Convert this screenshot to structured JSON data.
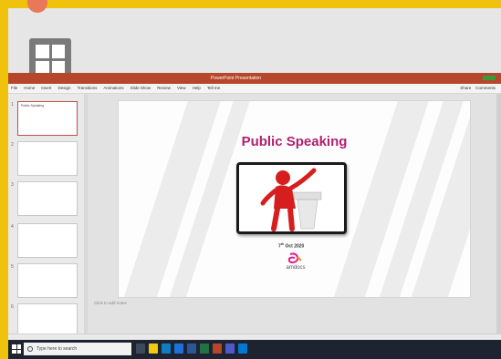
{
  "window": {
    "title": "PowerPoint Presentation",
    "title_left": "",
    "title_right": ""
  },
  "menu": {
    "items": [
      "File",
      "Home",
      "Insert",
      "Design",
      "Transitions",
      "Animations",
      "Slide Show",
      "Review",
      "View",
      "Help",
      "Tell me"
    ],
    "share": "Share",
    "comments": "Comments"
  },
  "thumbnails": [
    {
      "num": "1",
      "title": "Public Speaking",
      "selected": true
    },
    {
      "num": "2",
      "title": "",
      "selected": false
    },
    {
      "num": "3",
      "title": "",
      "selected": false
    },
    {
      "num": "4",
      "title": "",
      "selected": false
    },
    {
      "num": "5",
      "title": "",
      "selected": false
    },
    {
      "num": "6",
      "title": "",
      "selected": false
    }
  ],
  "slide": {
    "title": "Public Speaking",
    "date_day": "7",
    "date_suffix": "th",
    "date_rest": "Oct 2020",
    "logo_text": "amdocs",
    "footer": ""
  },
  "notes": {
    "placeholder": "Click to add notes"
  },
  "status": {
    "left": "",
    "right": ""
  },
  "taskbar": {
    "search_placeholder": "Type here to search",
    "time": "",
    "date": ""
  },
  "colors": {
    "accent_title": "#b01f6f",
    "ribbon": "#b7472a",
    "frame": "#f0c20e"
  }
}
